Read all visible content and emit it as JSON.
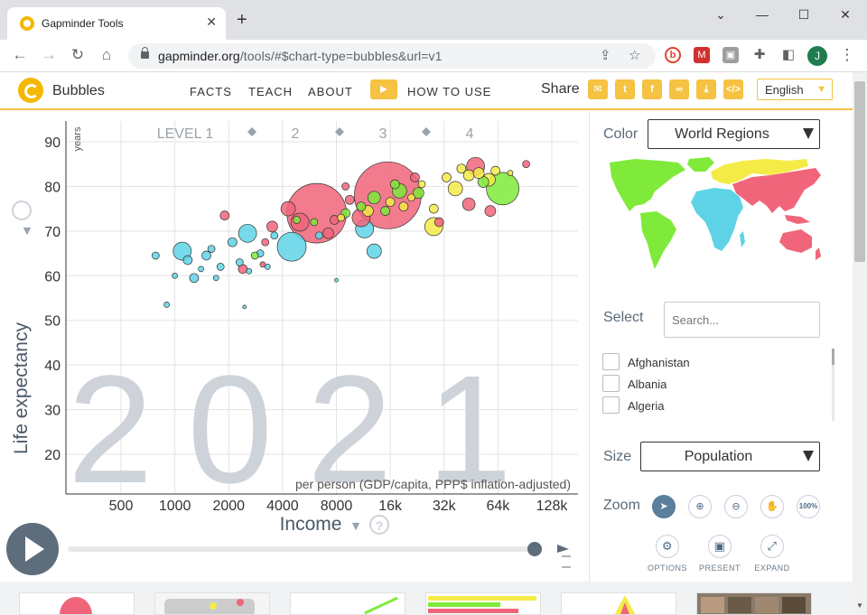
{
  "browser": {
    "tab_title": "Gapminder Tools",
    "url_host": "gapminder.org",
    "url_rest": "/tools/#$chart-type=bubbles&url=v1",
    "profile_initial": "J"
  },
  "app": {
    "title": "Bubbles",
    "menu": [
      "FACTS",
      "TEACH",
      "ABOUT"
    ],
    "how_to_use": "HOW TO USE",
    "share_label": "Share",
    "language": "English",
    "brand_color": "#f5c242"
  },
  "chart_data": {
    "type": "scatter",
    "year_label": "2021",
    "y_unit": "years",
    "ylabel": "Life expectancy",
    "xlabel": "Income",
    "x_sublabel": "per person (GDP/capita, PPP$ inflation-adjusted)",
    "x_scale": "log",
    "x_ticks": [
      "500",
      "1000",
      "2000",
      "4000",
      "8000",
      "16k",
      "32k",
      "64k",
      "128k"
    ],
    "y_ticks": [
      20,
      30,
      40,
      50,
      60,
      70,
      80,
      90
    ],
    "ylim": [
      15,
      93
    ],
    "level_labels": [
      "LEVEL 1",
      "2",
      "3",
      "4"
    ],
    "grid": true,
    "region_colors": {
      "africa": "#5fd3e6",
      "americas": "#7fea3a",
      "asia": "#f0657a",
      "europe": "#f5eb47"
    },
    "bubbles": [
      {
        "x": 1100,
        "y": 65.5,
        "r": 10,
        "region": "africa"
      },
      {
        "x": 2550,
        "y": 69.5,
        "r": 10,
        "region": "africa"
      },
      {
        "x": 4500,
        "y": 66.5,
        "r": 16,
        "region": "africa"
      },
      {
        "x": 13000,
        "y": 65.5,
        "r": 8,
        "region": "africa"
      },
      {
        "x": 11500,
        "y": 70.5,
        "r": 10,
        "region": "africa"
      },
      {
        "x": 1180,
        "y": 63.5,
        "r": 5,
        "region": "africa"
      },
      {
        "x": 1280,
        "y": 59.5,
        "r": 5,
        "region": "africa"
      },
      {
        "x": 1500,
        "y": 64.5,
        "r": 5,
        "region": "africa"
      },
      {
        "x": 1600,
        "y": 66.0,
        "r": 4,
        "region": "africa"
      },
      {
        "x": 1800,
        "y": 62.0,
        "r": 4,
        "region": "africa"
      },
      {
        "x": 2100,
        "y": 67.5,
        "r": 5,
        "region": "africa"
      },
      {
        "x": 2300,
        "y": 63.0,
        "r": 4,
        "region": "africa"
      },
      {
        "x": 2600,
        "y": 61.0,
        "r": 3,
        "region": "africa"
      },
      {
        "x": 3000,
        "y": 65.0,
        "r": 4,
        "region": "africa"
      },
      {
        "x": 3300,
        "y": 62.0,
        "r": 3,
        "region": "africa"
      },
      {
        "x": 3600,
        "y": 69.0,
        "r": 4,
        "region": "africa"
      },
      {
        "x": 900,
        "y": 53.5,
        "r": 3,
        "region": "africa"
      },
      {
        "x": 1000,
        "y": 60.0,
        "r": 3,
        "region": "africa"
      },
      {
        "x": 780,
        "y": 64.5,
        "r": 4,
        "region": "africa"
      },
      {
        "x": 6400,
        "y": 69.0,
        "r": 4,
        "region": "africa"
      },
      {
        "x": 8000,
        "y": 59.0,
        "r": 2,
        "region": "africa"
      },
      {
        "x": 2450,
        "y": 53.0,
        "r": 2,
        "region": "africa"
      },
      {
        "x": 1400,
        "y": 61.5,
        "r": 3,
        "region": "africa"
      },
      {
        "x": 1700,
        "y": 59.5,
        "r": 3,
        "region": "africa"
      },
      {
        "x": 6200,
        "y": 74.0,
        "r": 33,
        "region": "asia"
      },
      {
        "x": 15500,
        "y": 78.0,
        "r": 37,
        "region": "asia"
      },
      {
        "x": 5000,
        "y": 72.0,
        "r": 10,
        "region": "asia"
      },
      {
        "x": 4300,
        "y": 75.0,
        "r": 8,
        "region": "asia"
      },
      {
        "x": 11000,
        "y": 73.0,
        "r": 10,
        "region": "asia"
      },
      {
        "x": 48000,
        "y": 84.5,
        "r": 10,
        "region": "asia"
      },
      {
        "x": 44000,
        "y": 76.0,
        "r": 7,
        "region": "asia"
      },
      {
        "x": 1900,
        "y": 73.5,
        "r": 5,
        "region": "asia"
      },
      {
        "x": 2400,
        "y": 61.5,
        "r": 5,
        "region": "asia"
      },
      {
        "x": 3500,
        "y": 71.0,
        "r": 6,
        "region": "asia"
      },
      {
        "x": 7200,
        "y": 69.5,
        "r": 6,
        "region": "asia"
      },
      {
        "x": 7800,
        "y": 72.5,
        "r": 5,
        "region": "asia"
      },
      {
        "x": 9500,
        "y": 77.0,
        "r": 5,
        "region": "asia"
      },
      {
        "x": 30000,
        "y": 72.0,
        "r": 5,
        "region": "asia"
      },
      {
        "x": 58000,
        "y": 74.5,
        "r": 6,
        "region": "asia"
      },
      {
        "x": 92000,
        "y": 85.0,
        "r": 4,
        "region": "asia"
      },
      {
        "x": 3100,
        "y": 62.5,
        "r": 3,
        "region": "asia"
      },
      {
        "x": 9000,
        "y": 80.0,
        "r": 4,
        "region": "asia"
      },
      {
        "x": 22000,
        "y": 82.0,
        "r": 5,
        "region": "asia"
      },
      {
        "x": 3200,
        "y": 67.5,
        "r": 4,
        "region": "asia"
      },
      {
        "x": 13000,
        "y": 77.5,
        "r": 7,
        "region": "americas"
      },
      {
        "x": 68000,
        "y": 79.5,
        "r": 18,
        "region": "americas"
      },
      {
        "x": 18000,
        "y": 79.0,
        "r": 8,
        "region": "americas"
      },
      {
        "x": 23000,
        "y": 78.5,
        "r": 6,
        "region": "americas"
      },
      {
        "x": 11000,
        "y": 75.5,
        "r": 5,
        "region": "americas"
      },
      {
        "x": 9000,
        "y": 74.0,
        "r": 5,
        "region": "americas"
      },
      {
        "x": 15000,
        "y": 74.5,
        "r": 5,
        "region": "americas"
      },
      {
        "x": 2800,
        "y": 64.5,
        "r": 4,
        "region": "americas"
      },
      {
        "x": 17000,
        "y": 80.5,
        "r": 5,
        "region": "americas"
      },
      {
        "x": 53000,
        "y": 81.0,
        "r": 6,
        "region": "americas"
      },
      {
        "x": 6000,
        "y": 72.0,
        "r": 4,
        "region": "americas"
      },
      {
        "x": 4800,
        "y": 72.5,
        "r": 4,
        "region": "americas"
      },
      {
        "x": 28000,
        "y": 71.0,
        "r": 10,
        "region": "europe"
      },
      {
        "x": 37000,
        "y": 79.5,
        "r": 8,
        "region": "europe"
      },
      {
        "x": 57000,
        "y": 81.5,
        "r": 7,
        "region": "europe"
      },
      {
        "x": 44000,
        "y": 82.5,
        "r": 6,
        "region": "europe"
      },
      {
        "x": 50000,
        "y": 83.0,
        "r": 6,
        "region": "europe"
      },
      {
        "x": 12000,
        "y": 74.5,
        "r": 6,
        "region": "europe"
      },
      {
        "x": 33000,
        "y": 82.0,
        "r": 5,
        "region": "europe"
      },
      {
        "x": 28000,
        "y": 75.0,
        "r": 5,
        "region": "europe"
      },
      {
        "x": 40000,
        "y": 84.0,
        "r": 5,
        "region": "europe"
      },
      {
        "x": 62000,
        "y": 83.5,
        "r": 5,
        "region": "europe"
      },
      {
        "x": 16000,
        "y": 76.5,
        "r": 5,
        "region": "europe"
      },
      {
        "x": 19000,
        "y": 75.5,
        "r": 5,
        "region": "europe"
      },
      {
        "x": 21000,
        "y": 77.5,
        "r": 4,
        "region": "europe"
      },
      {
        "x": 24000,
        "y": 80.5,
        "r": 4,
        "region": "europe"
      },
      {
        "x": 75000,
        "y": 83.0,
        "r": 3,
        "region": "europe"
      },
      {
        "x": 8500,
        "y": 73.0,
        "r": 4,
        "region": "europe"
      }
    ]
  },
  "timeline": {
    "progress": 1.0
  },
  "side_panel": {
    "color_label": "Color",
    "color_value": "World Regions",
    "select_label": "Select",
    "search_placeholder": "Search...",
    "countries": [
      "Afghanistan",
      "Albania",
      "Algeria"
    ],
    "size_label": "Size",
    "size_value": "Population",
    "zoom_label": "Zoom",
    "zoom_100": "100%",
    "tools": [
      "OPTIONS",
      "PRESENT",
      "EXPAND"
    ]
  }
}
